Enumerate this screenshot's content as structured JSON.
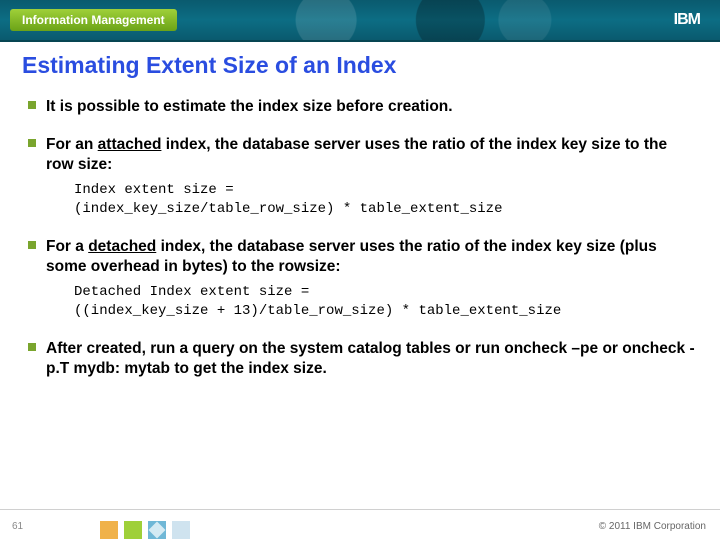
{
  "header": {
    "brand": "Information Management",
    "logo": "IBM"
  },
  "title": "Estimating Extent Size of an Index",
  "bullets": {
    "b1": "It is possible to estimate the index size before creation.",
    "b2_pre": "For an ",
    "b2_u": "attached",
    "b2_post": " index, the database server uses the ratio of the index key size to the row size:",
    "b2_formula": "Index extent size =\n(index_key_size/table_row_size) * table_extent_size",
    "b3_pre": "For a ",
    "b3_u": "detached",
    "b3_post": " index, the database server uses the ratio of the index key size (plus some overhead in bytes) to the rowsize:",
    "b3_formula": "Detached Index extent size =\n((index_key_size + 13)/table_row_size) * table_extent_size",
    "b4": "After created, run a query on the system catalog tables or run oncheck –pe or oncheck -p.T mydb: mytab to get the index size."
  },
  "footer": {
    "page": "61",
    "copyright": "© 2011 IBM Corporation"
  }
}
